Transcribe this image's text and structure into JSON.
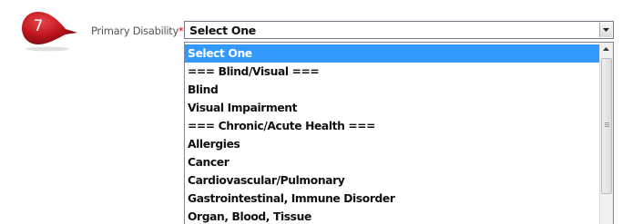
{
  "step": {
    "number": "7",
    "badge_color": "#c0141c"
  },
  "field": {
    "label": "Primary Disability",
    "required_marker": "*",
    "label_suffix": ":"
  },
  "select": {
    "value": "Select One"
  },
  "dropdown": {
    "highlight_color": "#3399ff",
    "options": [
      {
        "label": "Select One",
        "selected": true
      },
      {
        "label": "=== Blind/Visual ==="
      },
      {
        "label": "Blind"
      },
      {
        "label": "Visual Impairment"
      },
      {
        "label": "=== Chronic/Acute Health ==="
      },
      {
        "label": "Allergies"
      },
      {
        "label": "Cancer"
      },
      {
        "label": "Cardiovascular/Pulmonary"
      },
      {
        "label": "Gastrointestinal, Immune Disorder"
      },
      {
        "label": "Organ, Blood, Tissue"
      }
    ]
  }
}
